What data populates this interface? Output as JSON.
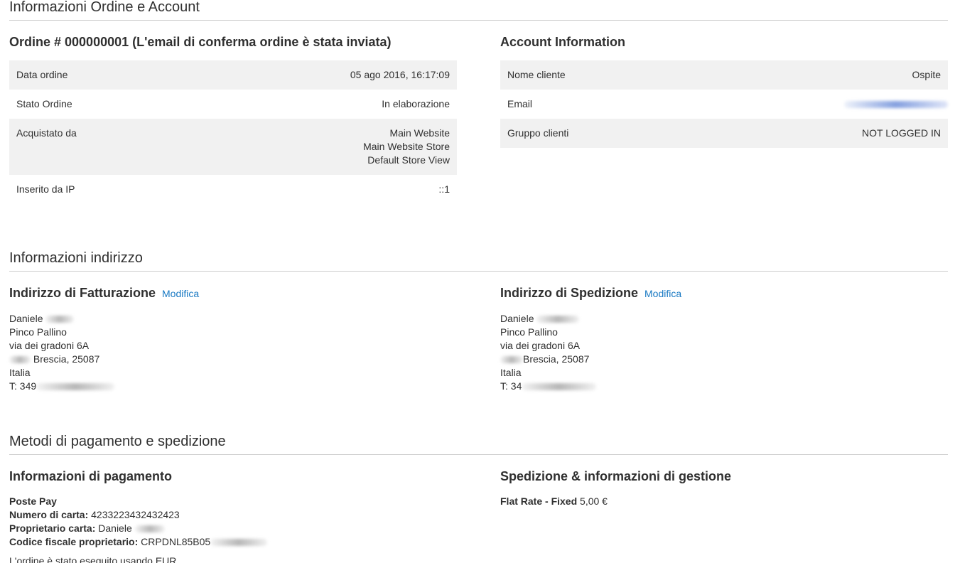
{
  "order_account": {
    "section_title": "Informazioni Ordine e Account",
    "order": {
      "title": "Ordine # 000000001 (L'email di conferma ordine è stata inviata)",
      "rows": [
        {
          "label": "Data ordine",
          "value": "05 ago 2016, 16:17:09"
        },
        {
          "label": "Stato Ordine",
          "value": "In elaborazione"
        },
        {
          "label": "Acquistato da",
          "lines": [
            "Main Website",
            "Main Website Store",
            "Default Store View"
          ]
        },
        {
          "label": "Inserito da IP",
          "value": "::1"
        }
      ]
    },
    "account": {
      "title": "Account Information",
      "rows": [
        {
          "label": "Nome cliente",
          "value": "Ospite"
        },
        {
          "label": "Email",
          "value": ""
        },
        {
          "label": "Gruppo clienti",
          "value": "NOT LOGGED IN"
        }
      ]
    }
  },
  "address": {
    "section_title": "Informazioni indirizzo",
    "billing": {
      "title": "Indirizzo di Fatturazione",
      "edit_label": "Modifica",
      "name": "Daniele",
      "company": "Pinco Pallino",
      "street": "via dei gradoni 6A",
      "city_zip": "Brescia, 25087",
      "country": "Italia",
      "phone_prefix": "T: 349"
    },
    "shipping": {
      "title": "Indirizzo di Spedizione",
      "edit_label": "Modifica",
      "name": "Daniele",
      "company": "Pinco Pallino",
      "street": "via dei gradoni 6A",
      "city_zip": "Brescia, 25087",
      "country": "Italia",
      "phone_prefix": "T: 34"
    }
  },
  "payment_shipping": {
    "section_title": "Metodi di pagamento e spedizione",
    "payment": {
      "title": "Informazioni di pagamento",
      "method": "Poste Pay",
      "card_number_label": "Numero di carta:",
      "card_number": "4233223432432423",
      "card_owner_label": "Proprietario carta:",
      "card_owner": "Daniele",
      "tax_code_label": "Codice fiscale proprietario:",
      "tax_code": "CRPDNL85B05",
      "currency_note": "L'ordine è stato eseguito usando EUR."
    },
    "shipping": {
      "title": "Spedizione & informazioni di gestione",
      "method": "Flat Rate - Fixed",
      "price": "5,00 €"
    }
  }
}
